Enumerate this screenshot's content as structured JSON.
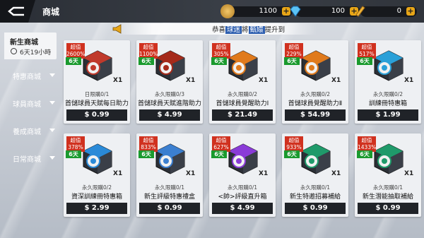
{
  "header": {
    "title": "商城"
  },
  "currencies": [
    {
      "name": "coin",
      "value": "1100",
      "color": "#d9a441"
    },
    {
      "name": "diamond",
      "value": "100",
      "color": "#4ab4f0"
    },
    {
      "name": "ticket",
      "value": "0",
      "color": "#e8a617"
    }
  ],
  "announcement": {
    "prefix": "恭喜",
    "player": "球迷",
    "mid": "將",
    "item": "甄嬛",
    "suffix": "提升到"
  },
  "sidebar": {
    "active": {
      "label": "新生商城",
      "timer": "6天19小時"
    },
    "items": [
      {
        "label": "特惠商城"
      },
      {
        "label": "球員商城"
      },
      {
        "label": "養成商城"
      },
      {
        "label": "日常商城"
      }
    ]
  },
  "products": [
    {
      "badge_label": "超值",
      "badge_pct": "2600%",
      "days": "6天",
      "qty": "X1",
      "limit": "日限購0/1",
      "name": "首儲球員天賦每日助力",
      "price": "$ 0.99",
      "accent": "#c0392b"
    },
    {
      "badge_label": "超值",
      "badge_pct": "1100%",
      "days": "6天",
      "qty": "X1",
      "limit": "永久限購0/3",
      "name": "首儲球員天賦進階助力",
      "price": "$ 4.99",
      "accent": "#a52a1a"
    },
    {
      "badge_label": "超值",
      "badge_pct": "305%",
      "days": "6天",
      "qty": "X1",
      "limit": "永久限購0/2",
      "name": "首儲球員覺醒助力Ⅰ",
      "price": "$ 21.49",
      "accent": "#e07a1c"
    },
    {
      "badge_label": "超值",
      "badge_pct": "229%",
      "days": "6天",
      "qty": "X1",
      "limit": "永久限購0/2",
      "name": "首儲球員覺醒助力Ⅱ",
      "price": "$ 54.99",
      "accent": "#e07a1c"
    },
    {
      "badge_label": "超值",
      "badge_pct": "517%",
      "days": "6天",
      "qty": "X1",
      "limit": "永久限購0/2",
      "name": "訓練冊特惠箱",
      "price": "$ 1.99",
      "accent": "#2aa0d8"
    },
    {
      "badge_label": "超值",
      "badge_pct": "378%",
      "days": "6天",
      "qty": "X1",
      "limit": "永久限購0/2",
      "name": "資深訓練冊特惠箱",
      "price": "$ 2.99",
      "accent": "#2a8ad8"
    },
    {
      "badge_label": "超值",
      "badge_pct": "833%",
      "days": "6天",
      "qty": "X1",
      "limit": "永久限購0/1",
      "name": "新生評級特惠禮盒",
      "price": "$ 0.99",
      "accent": "#3b7fd0"
    },
    {
      "badge_label": "超值",
      "badge_pct": "627%",
      "days": "6天",
      "qty": "X1",
      "limit": "永久限購0/1",
      "name": "<帥>評級直升箱",
      "price": "$ 4.99",
      "accent": "#8a3bd8"
    },
    {
      "badge_label": "超值",
      "badge_pct": "933%",
      "days": "6天",
      "qty": "X1",
      "limit": "永久限購0/1",
      "name": "新生特邀招募補給",
      "price": "$ 0.99",
      "accent": "#1f9a6a"
    },
    {
      "badge_label": "超值",
      "badge_pct": "1433%",
      "days": "6天",
      "qty": "X1",
      "limit": "永久限購0/1",
      "name": "新生潛能抽取補給",
      "price": "$ 0.99",
      "accent": "#1f9a6a"
    }
  ]
}
